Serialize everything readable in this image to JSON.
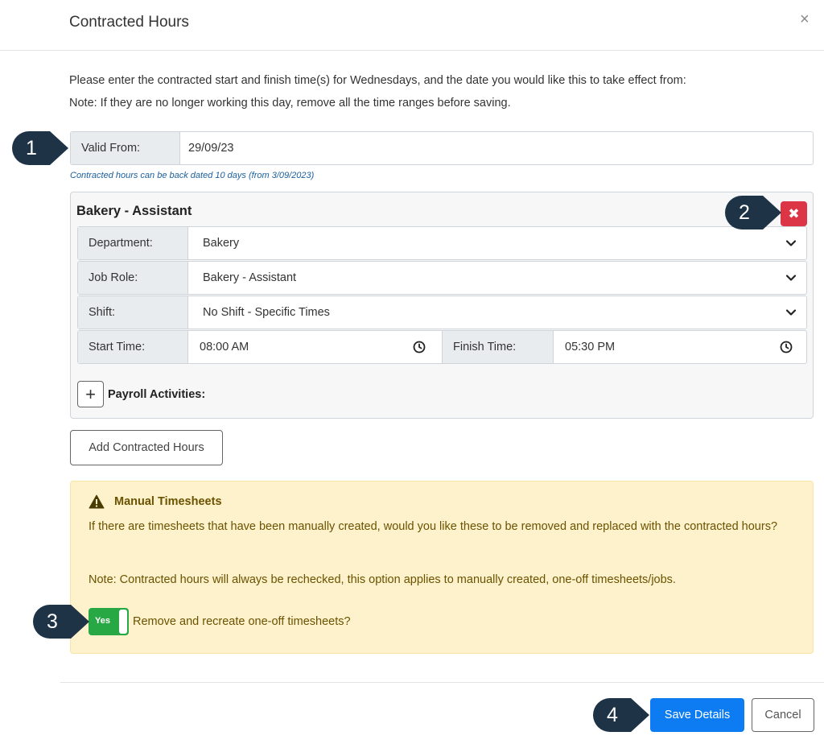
{
  "dialog": {
    "title": "Contracted Hours",
    "close_glyph": "×",
    "intro_line1": "Please enter the contracted start and finish time(s) for Wednesdays, and the date you would like this to take effect from:",
    "intro_line2": "Note: If they are no longer working this day, remove all the time ranges before saving."
  },
  "valid_from": {
    "label": "Valid From:",
    "value": "29/09/23",
    "help": "Contracted hours can be back dated 10 days (from 3/09/2023)"
  },
  "card": {
    "title": "Bakery - Assistant",
    "delete_glyph": "✖",
    "department": {
      "label": "Department:",
      "value": "Bakery"
    },
    "job_role": {
      "label": "Job Role:",
      "value": "Bakery - Assistant"
    },
    "shift": {
      "label": "Shift:",
      "value": "No Shift - Specific Times"
    },
    "start_time": {
      "label": "Start Time:",
      "value": "08:00 AM"
    },
    "finish_time": {
      "label": "Finish Time:",
      "value": "05:30 PM"
    },
    "payroll": {
      "plus_glyph": "+",
      "label": "Payroll Activities:"
    }
  },
  "add_button": "Add Contracted Hours",
  "alert": {
    "heading": "Manual Timesheets",
    "text1": "If there are timesheets that have been manually created, would you like these to be removed and replaced with the contracted hours?",
    "text2": "Note: Contracted hours will always be rechecked, this option applies to manually created, one-off timesheets/jobs.",
    "toggle_label": "Yes",
    "toggle_text": "Remove and recreate one-off timesheets?"
  },
  "footer": {
    "save_label": "Save Details",
    "cancel_label": "Cancel"
  },
  "callouts": [
    "1",
    "2",
    "3",
    "4"
  ],
  "colors": {
    "callout": "#1f3347",
    "danger": "#dc3545",
    "primary": "#0d7cf2",
    "success": "#28a745",
    "warning_bg": "#fdf2cc"
  }
}
